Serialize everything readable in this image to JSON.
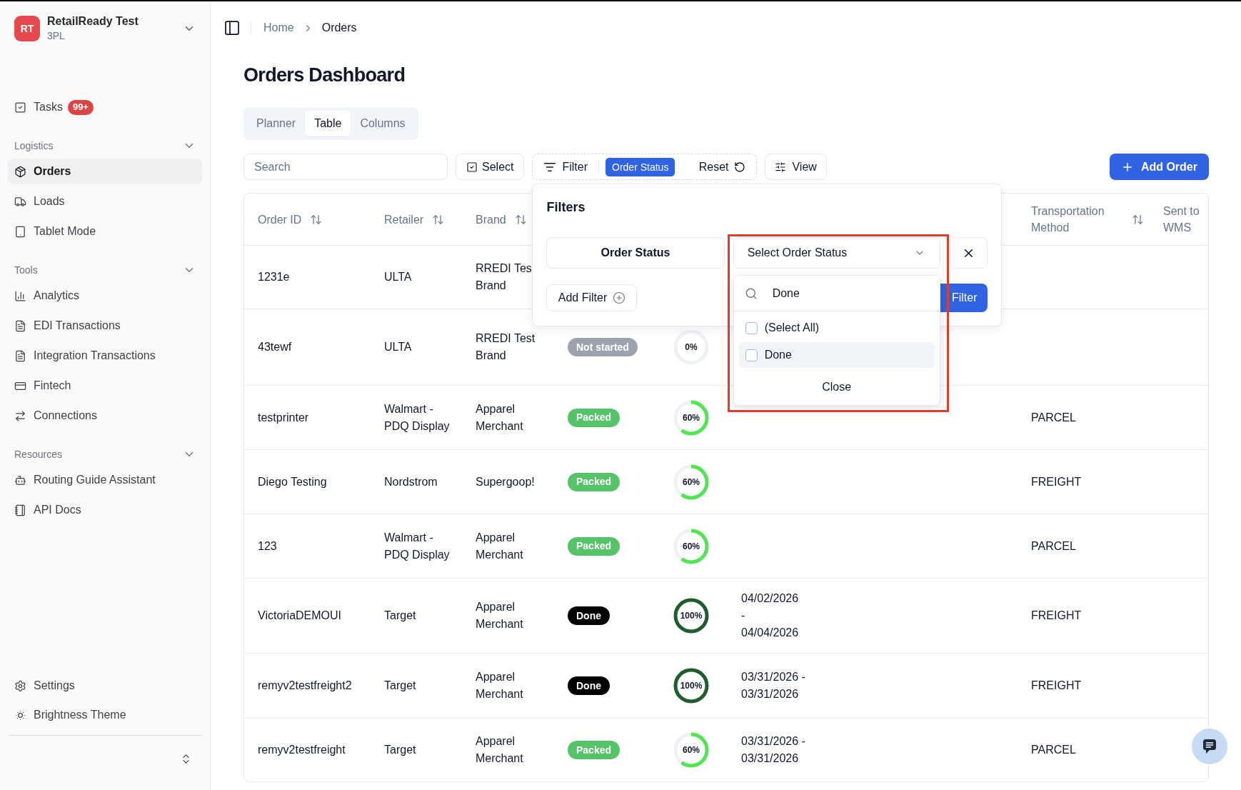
{
  "workspace": {
    "initials": "RT",
    "name": "RetailReady Test",
    "subtitle": "3PL"
  },
  "sidebar": {
    "top_items": [
      {
        "label": "Tasks",
        "badge": "99+",
        "selected": false
      }
    ],
    "sections": [
      {
        "title": "Logistics",
        "expanded": true,
        "items": [
          {
            "label": "Orders",
            "selected": true
          },
          {
            "label": "Loads",
            "selected": false
          },
          {
            "label": "Tablet Mode",
            "selected": false
          }
        ]
      },
      {
        "title": "Tools",
        "expanded": true,
        "items": [
          {
            "label": "Analytics",
            "selected": false
          },
          {
            "label": "EDI Transactions",
            "selected": false
          },
          {
            "label": "Integration Transactions",
            "selected": false
          },
          {
            "label": "Fintech",
            "selected": false
          },
          {
            "label": "Connections",
            "selected": false
          }
        ]
      },
      {
        "title": "Resources",
        "expanded": true,
        "items": [
          {
            "label": "Routing Guide Assistant",
            "selected": false
          },
          {
            "label": "API Docs",
            "selected": false
          }
        ]
      }
    ],
    "bottom_items": [
      {
        "label": "Settings",
        "selected": false
      },
      {
        "label": "Brightness Theme",
        "selected": false
      }
    ]
  },
  "breadcrumb": [
    "Home",
    "Orders"
  ],
  "page_title": "Orders Dashboard",
  "tabs": [
    {
      "label": "Planner",
      "selected": false
    },
    {
      "label": "Table",
      "selected": true
    },
    {
      "label": "Columns",
      "selected": false
    }
  ],
  "toolbar": {
    "search": {
      "placeholder": "Search"
    },
    "select_button": "Select",
    "filter": {
      "label": "Filter",
      "active_filters": [
        "Order Status"
      ],
      "reset": "Reset"
    },
    "view_button": "View",
    "add_button": "Add Order"
  },
  "table": {
    "columns": [
      {
        "label": "Order ID",
        "sortable": true
      },
      {
        "label": "Retailer",
        "sortable": true
      },
      {
        "label": "Brand",
        "sortable": true
      },
      {
        "label": "Transportation Method",
        "sortable": true
      },
      {
        "label": "Sent to WMS",
        "sortable": false
      }
    ],
    "rows": [
      {
        "order_id": "1231e",
        "retailer": "ULTA",
        "brand": "RREDI Tes Brand"
      },
      {
        "order_id": "43tewf",
        "retailer": "ULTA",
        "brand": "RREDI Test Brand",
        "status": {
          "label": "Not started",
          "kind": "not_started"
        },
        "progress": {
          "label": "0%",
          "level": 0
        }
      },
      {
        "order_id": "testprinter",
        "retailer": "Walmart - PDQ Display",
        "brand": "Apparel Merchant",
        "status": {
          "label": "Packed",
          "kind": "packed"
        },
        "progress": {
          "label": "60%",
          "level": 0.6
        },
        "transportation": "PARCEL"
      },
      {
        "order_id": "Diego Testing",
        "retailer": "Nordstrom",
        "brand": "Supergoop!",
        "status": {
          "label": "Packed",
          "kind": "packed"
        },
        "progress": {
          "label": "60%",
          "level": 0.6
        },
        "transportation": "FREIGHT"
      },
      {
        "order_id": "123",
        "retailer": "Walmart - PDQ Display",
        "brand": "Apparel Merchant",
        "status": {
          "label": "Packed",
          "kind": "packed"
        },
        "progress": {
          "label": "60%",
          "level": 0.6
        },
        "transportation": "PARCEL"
      },
      {
        "order_id": "VictoriaDEMOUI",
        "retailer": "Target",
        "brand": "Apparel Merchant",
        "status": {
          "label": "Done",
          "kind": "done"
        },
        "progress": {
          "label": "100%",
          "level": 1
        },
        "dates": "04/02/2026\n-\n04/04/2026",
        "transportation": "FREIGHT"
      },
      {
        "order_id": "remyv2testfreight2",
        "retailer": "Target",
        "brand": "Apparel Merchant",
        "status": {
          "label": "Done",
          "kind": "done"
        },
        "progress": {
          "label": "100%",
          "level": 1
        },
        "dates": "03/31/2026 -\n03/31/2026",
        "transportation": "FREIGHT"
      },
      {
        "order_id": "remyv2testfreight",
        "retailer": "Target",
        "brand": "Apparel Merchant",
        "status": {
          "label": "Packed",
          "kind": "packed"
        },
        "progress": {
          "label": "60%",
          "level": 0.6
        },
        "dates": "03/31/2026 -\n03/31/2026",
        "transportation": "PARCEL"
      }
    ]
  },
  "filter_popover": {
    "title": "Filters",
    "rules": [
      {
        "field": "Order Status",
        "prompt": "Select Order Status",
        "open": true
      }
    ],
    "add_filter": "Add Filter",
    "apply_button": "Filter",
    "dropdown": {
      "search_value": "Done",
      "options": [
        {
          "label": "(Select All)",
          "checked": false,
          "highlighted": false
        },
        {
          "label": "Done",
          "checked": false,
          "highlighted": true
        }
      ],
      "close": "Close"
    }
  }
}
